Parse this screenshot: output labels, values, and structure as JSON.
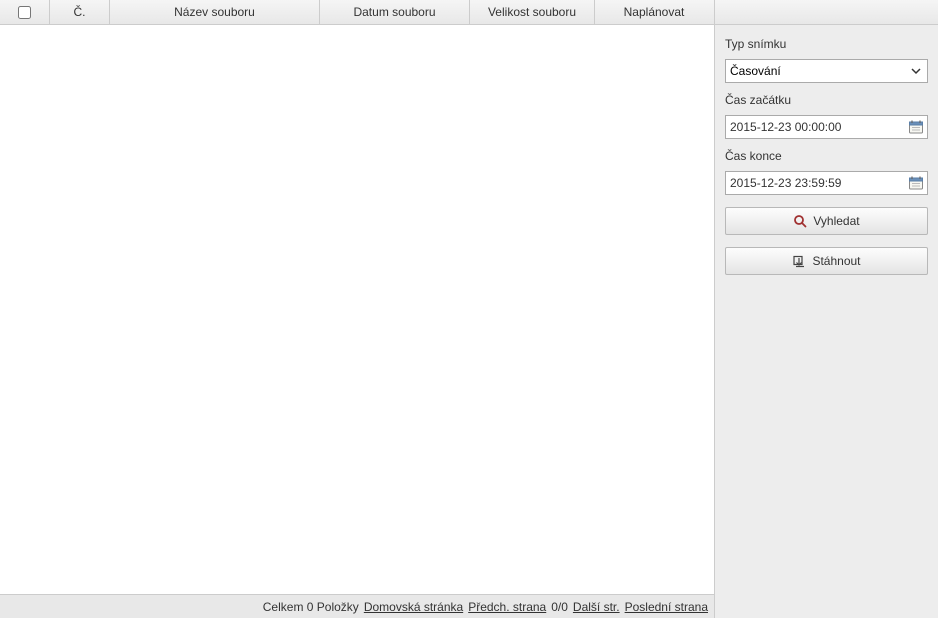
{
  "table": {
    "headers": {
      "num": "Č.",
      "name": "Název souboru",
      "date": "Datum souboru",
      "size": "Velikost souboru",
      "plan": "Naplánovat"
    },
    "rows": []
  },
  "footer": {
    "total_text": "Celkem 0 Položky",
    "home": "Domovská stránka",
    "prev": "Předch. strana",
    "page_indicator": "0/0",
    "next": "Další str.",
    "last": "Poslední strana"
  },
  "sidebar": {
    "type_label": "Typ snímku",
    "type_value": "Časování",
    "start_label": "Čas začátku",
    "start_value": "2015-12-23 00:00:00",
    "end_label": "Čas konce",
    "end_value": "2015-12-23 23:59:59",
    "search_label": "Vyhledat",
    "download_label": "Stáhnout"
  }
}
